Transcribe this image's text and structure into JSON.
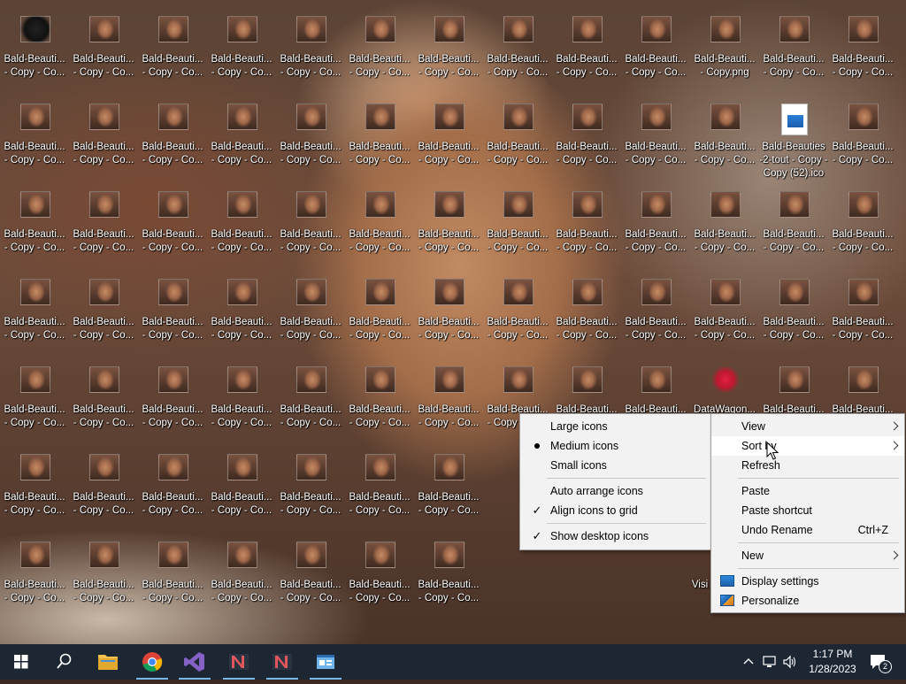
{
  "desktop": {
    "file_label_line1": "Bald-Beauti...",
    "file_label_line2": "- Copy - Co...",
    "first_icon_line1": "Bald-Beauti...",
    "first_icon_line2": "- Copy - Co...",
    "copy_png_line2": "- Copy.png",
    "ico_label": "Bald-Beauties -2-tout - Copy - Copy (52).ico",
    "datawagon_label": "DataWagon...",
    "vis_label": "Visi"
  },
  "view_menu": {
    "large_icons": "Large icons",
    "medium_icons": "Medium icons",
    "small_icons": "Small icons",
    "auto_arrange": "Auto arrange icons",
    "align_to_grid": "Align icons to grid",
    "show_desktop_icons": "Show desktop icons",
    "check_glyph": "✓"
  },
  "context_menu": {
    "view": "View",
    "sort_by": "Sort by",
    "refresh": "Refresh",
    "paste": "Paste",
    "paste_shortcut": "Paste shortcut",
    "undo_rename": "Undo Rename",
    "undo_shortcut": "Ctrl+Z",
    "new": "New",
    "display_settings": "Display settings",
    "personalize": "Personalize"
  },
  "taskbar": {
    "time": "1:17 PM",
    "date": "1/28/2023",
    "notification_count": "2",
    "accent": "#76b9ed"
  }
}
